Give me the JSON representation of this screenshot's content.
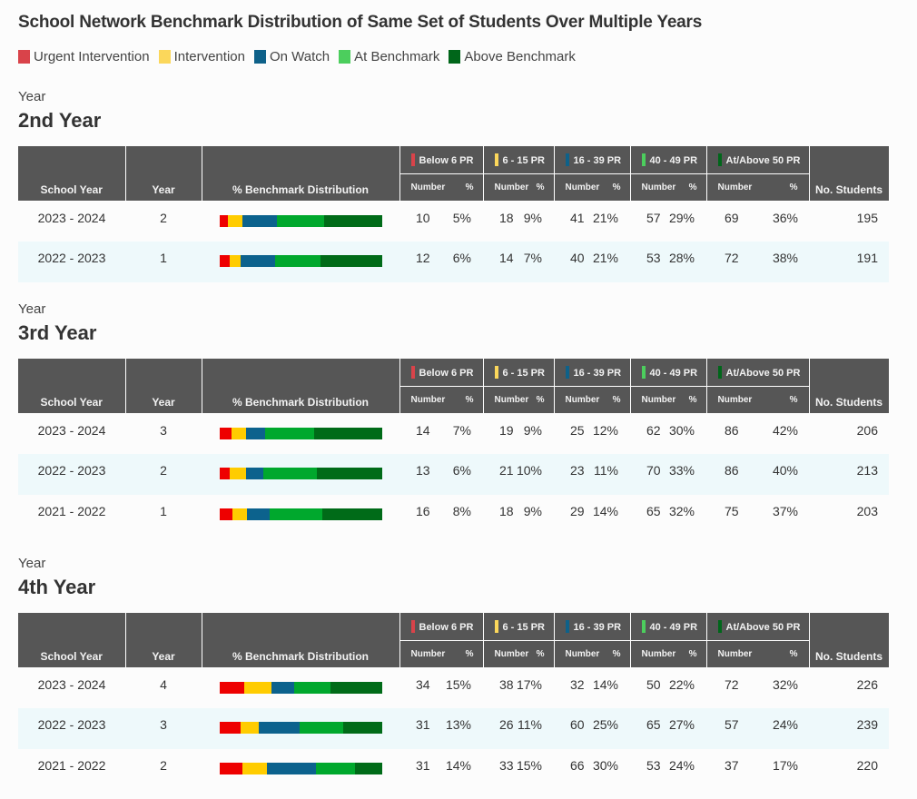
{
  "title": "School Network Benchmark Distribution of Same Set of Students Over Multiple Years",
  "legend": [
    {
      "label": "Urgent Intervention",
      "color": "#d9434a"
    },
    {
      "label": "Intervention",
      "color": "#fbd75b"
    },
    {
      "label": "On Watch",
      "color": "#0e6189"
    },
    {
      "label": "At Benchmark",
      "color": "#4cce5d"
    },
    {
      "label": "Above Benchmark",
      "color": "#00661a"
    }
  ],
  "bar_colors": [
    "#ee0000",
    "#ffcc00",
    "#0c628d",
    "#00a82d",
    "#006b18"
  ],
  "header": {
    "school_year": "School Year",
    "year": "Year",
    "distribution": "% Benchmark Distribution",
    "students": "No. Students",
    "number": "Number",
    "percent": "%",
    "groups": [
      {
        "label": "Below 6 PR",
        "color": "#d9434a"
      },
      {
        "label": "6 - 15 PR",
        "color": "#fbd75b"
      },
      {
        "label": "16 - 39 PR",
        "color": "#0e6189"
      },
      {
        "label": "40 - 49 PR",
        "color": "#4cce5d"
      },
      {
        "label": "At/Above 50 PR",
        "color": "#00661a"
      }
    ]
  },
  "chart_data": {
    "type": "table",
    "title": "School Network Benchmark Distribution of Same Set of Students Over Multiple Years",
    "sections": [
      {
        "kicker": "Year",
        "title": "2nd Year",
        "rows": [
          {
            "school_year": "2023 - 2024",
            "year": "2",
            "numbers": [
              10,
              18,
              41,
              57,
              69
            ],
            "percents": [
              "5%",
              "9%",
              "21%",
              "29%",
              "36%"
            ],
            "students": "195"
          },
          {
            "school_year": "2022 - 2023",
            "year": "1",
            "numbers": [
              12,
              14,
              40,
              53,
              72
            ],
            "percents": [
              "6%",
              "7%",
              "21%",
              "28%",
              "38%"
            ],
            "students": "191"
          }
        ]
      },
      {
        "kicker": "Year",
        "title": "3rd Year",
        "rows": [
          {
            "school_year": "2023 - 2024",
            "year": "3",
            "numbers": [
              14,
              19,
              25,
              62,
              86
            ],
            "percents": [
              "7%",
              "9%",
              "12%",
              "30%",
              "42%"
            ],
            "students": "206"
          },
          {
            "school_year": "2022 - 2023",
            "year": "2",
            "numbers": [
              13,
              21,
              23,
              70,
              86
            ],
            "percents": [
              "6%",
              "10%",
              "11%",
              "33%",
              "40%"
            ],
            "students": "213"
          },
          {
            "school_year": "2021 - 2022",
            "year": "1",
            "numbers": [
              16,
              18,
              29,
              65,
              75
            ],
            "percents": [
              "8%",
              "9%",
              "14%",
              "32%",
              "37%"
            ],
            "students": "203"
          }
        ]
      },
      {
        "kicker": "Year",
        "title": "4th Year",
        "rows": [
          {
            "school_year": "2023 - 2024",
            "year": "4",
            "numbers": [
              34,
              38,
              32,
              50,
              72
            ],
            "percents": [
              "15%",
              "17%",
              "14%",
              "22%",
              "32%"
            ],
            "students": "226"
          },
          {
            "school_year": "2022 - 2023",
            "year": "3",
            "numbers": [
              31,
              26,
              60,
              65,
              57
            ],
            "percents": [
              "13%",
              "11%",
              "25%",
              "27%",
              "24%"
            ],
            "students": "239"
          },
          {
            "school_year": "2021 - 2022",
            "year": "2",
            "numbers": [
              31,
              33,
              66,
              53,
              37
            ],
            "percents": [
              "14%",
              "15%",
              "30%",
              "24%",
              "17%"
            ],
            "students": "220"
          }
        ]
      }
    ]
  }
}
